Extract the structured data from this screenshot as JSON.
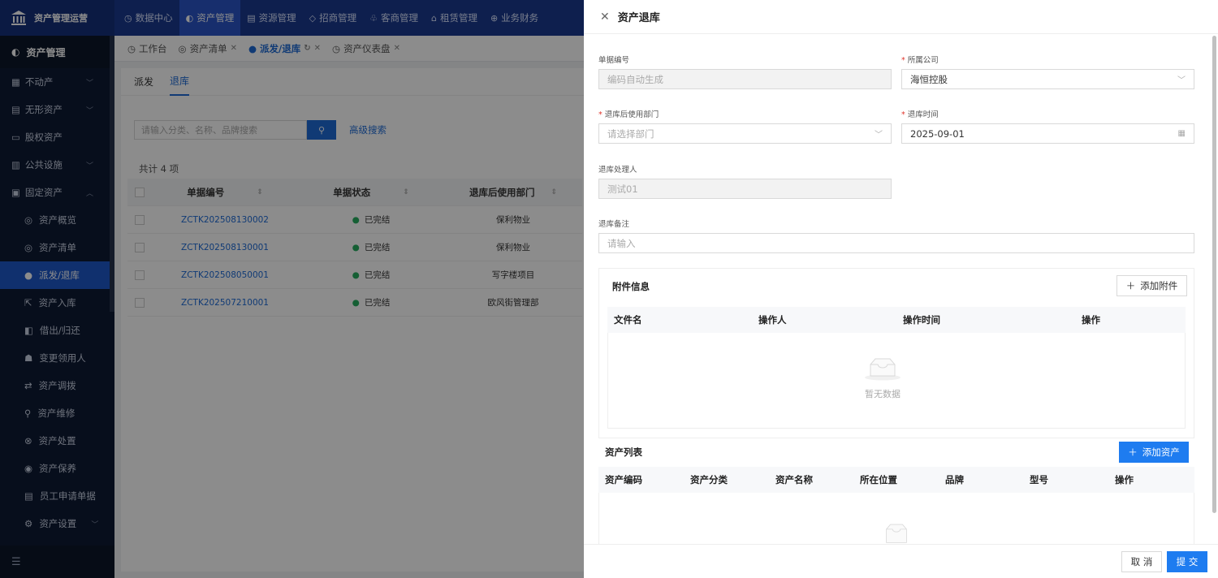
{
  "brand": {
    "name": "资产管理运营"
  },
  "topnav": [
    {
      "icon": "◷",
      "label": "数据中心",
      "active": false
    },
    {
      "icon": "◐",
      "label": "资产管理",
      "active": true
    },
    {
      "icon": "▤",
      "label": "资源管理",
      "active": false
    },
    {
      "icon": "◇",
      "label": "招商管理",
      "active": false
    },
    {
      "icon": "♧",
      "label": "客商管理",
      "active": false
    },
    {
      "icon": "⌂",
      "label": "租赁管理",
      "active": false
    },
    {
      "icon": "⊕",
      "label": "业务财务",
      "active": false
    }
  ],
  "sidebar": {
    "header": "资产管理",
    "groups": [
      {
        "icon": "▦",
        "label": "不动产"
      },
      {
        "icon": "▤",
        "label": "无形资产"
      },
      {
        "icon": "▭",
        "label": "股权资产"
      },
      {
        "icon": "▥",
        "label": "公共设施"
      },
      {
        "icon": "▣",
        "label": "固定资产"
      }
    ],
    "subitems": [
      {
        "icon": "◎",
        "label": "资产概览"
      },
      {
        "icon": "◎",
        "label": "资产清单"
      },
      {
        "icon": "●",
        "label": "派发/退库"
      },
      {
        "icon": "⇱",
        "label": "资产入库"
      },
      {
        "icon": "◧",
        "label": "借出/归还"
      },
      {
        "icon": "☗",
        "label": "变更领用人"
      },
      {
        "icon": "⇄",
        "label": "资产调拨"
      },
      {
        "icon": "⚲",
        "label": "资产维修"
      },
      {
        "icon": "⊗",
        "label": "资产处置"
      },
      {
        "icon": "◉",
        "label": "资产保养"
      },
      {
        "icon": "▤",
        "label": "员工申请单据"
      },
      {
        "icon": "⚙",
        "label": "资产设置"
      }
    ],
    "footer_icon": "☰"
  },
  "tabs": [
    {
      "icon": "◷",
      "label": "工作台"
    },
    {
      "icon": "◎",
      "label": "资产清单"
    },
    {
      "icon": "●",
      "label": "派发/退库"
    },
    {
      "icon": "◷",
      "label": "资产仪表盘"
    }
  ],
  "subtabs": [
    "派发",
    "退库"
  ],
  "search": {
    "placeholder": "请输入分类、名称、品牌搜索",
    "advanced": "高级搜索"
  },
  "list": {
    "total": "共计 4 项",
    "columns": [
      "单据编号",
      "单据状态",
      "退库后使用部门"
    ],
    "rows": [
      {
        "code": "ZCTK202508130002",
        "status": "已完结",
        "dept": "保利物业"
      },
      {
        "code": "ZCTK202508130001",
        "status": "已完结",
        "dept": "保利物业"
      },
      {
        "code": "ZCTK202508050001",
        "status": "已完结",
        "dept": "写字楼项目"
      },
      {
        "code": "ZCTK202507210001",
        "status": "已完结",
        "dept": "欧风街管理部"
      }
    ]
  },
  "drawer": {
    "title": "资产退库",
    "fields": {
      "doc_no": {
        "label": "单据编号",
        "value": "编码自动生成"
      },
      "company": {
        "label": "所属公司",
        "value": "海恒控股"
      },
      "dept": {
        "label": "退库后使用部门",
        "placeholder": "请选择部门"
      },
      "date": {
        "label": "退库时间",
        "value": "2025-09-01"
      },
      "handler": {
        "label": "退库处理人",
        "value": "测试01"
      },
      "remark": {
        "label": "退库备注",
        "placeholder": "请输入"
      }
    },
    "attachments": {
      "title": "附件信息",
      "add": "添加附件",
      "columns": [
        "文件名",
        "操作人",
        "操作时间",
        "操作"
      ],
      "empty": "暂无数据"
    },
    "assets": {
      "title": "资产列表",
      "add": "添加资产",
      "columns": [
        "资产编码",
        "资产分类",
        "资产名称",
        "所在位置",
        "品牌",
        "型号",
        "操作"
      ]
    },
    "footer": {
      "cancel": "取 消",
      "submit": "提 交"
    }
  }
}
